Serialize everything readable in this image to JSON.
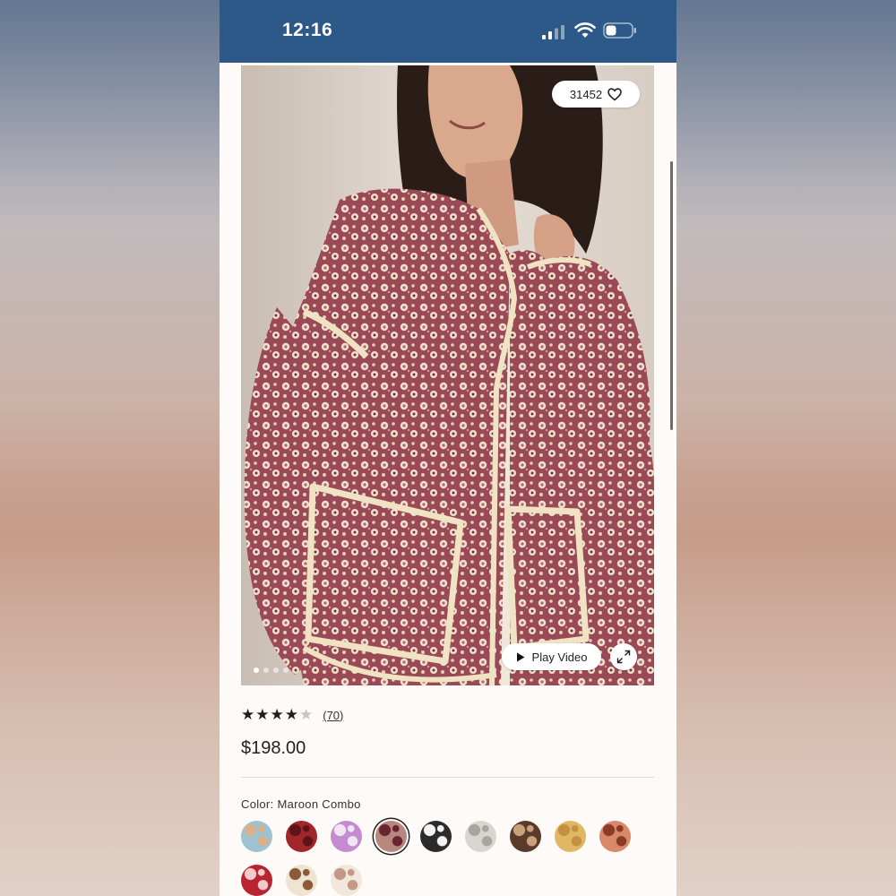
{
  "status_bar": {
    "time": "12:16"
  },
  "product": {
    "likes": "31452",
    "play_video_label": "Play Video",
    "rating": 4,
    "rating_max": 5,
    "review_count": "(70)",
    "price": "$198.00",
    "color_label": "Color:",
    "color_value": "Maroon Combo",
    "image_count": 4,
    "active_image": 0
  },
  "swatches": [
    {
      "name": "blue-floral",
      "color": "#9ec2cf",
      "accent": "#d9b08a"
    },
    {
      "name": "red-patchwork",
      "color": "#a3262a",
      "accent": "#5e1416"
    },
    {
      "name": "purple-floral",
      "color": "#c48bd0",
      "accent": "#f0e5f0"
    },
    {
      "name": "maroon-combo",
      "color": "#b8877e",
      "accent": "#6a2330",
      "selected": true
    },
    {
      "name": "black-check",
      "color": "#2b2b2b",
      "accent": "#f2f2f2"
    },
    {
      "name": "grey-floral",
      "color": "#d9d6d2",
      "accent": "#aaa49e"
    },
    {
      "name": "brown-plaid",
      "color": "#5a3a2a",
      "accent": "#c9a27c"
    },
    {
      "name": "mustard-floral",
      "color": "#e0b865",
      "accent": "#c39140"
    },
    {
      "name": "rust-floral",
      "color": "#d9886a",
      "accent": "#8a3c27"
    },
    {
      "name": "red-floral",
      "color": "#b82531",
      "accent": "#f3c9c9"
    },
    {
      "name": "cream-brown-floral",
      "color": "#efe4d1",
      "accent": "#8b5a3a"
    },
    {
      "name": "cream-rose-floral",
      "color": "#f1e7dc",
      "accent": "#c49787"
    }
  ],
  "colors": {
    "status_bar": "#2c5987",
    "jacket_base": "#9e4f5b",
    "jacket_print": "#efe0c8",
    "piping": "#eee2c2"
  }
}
